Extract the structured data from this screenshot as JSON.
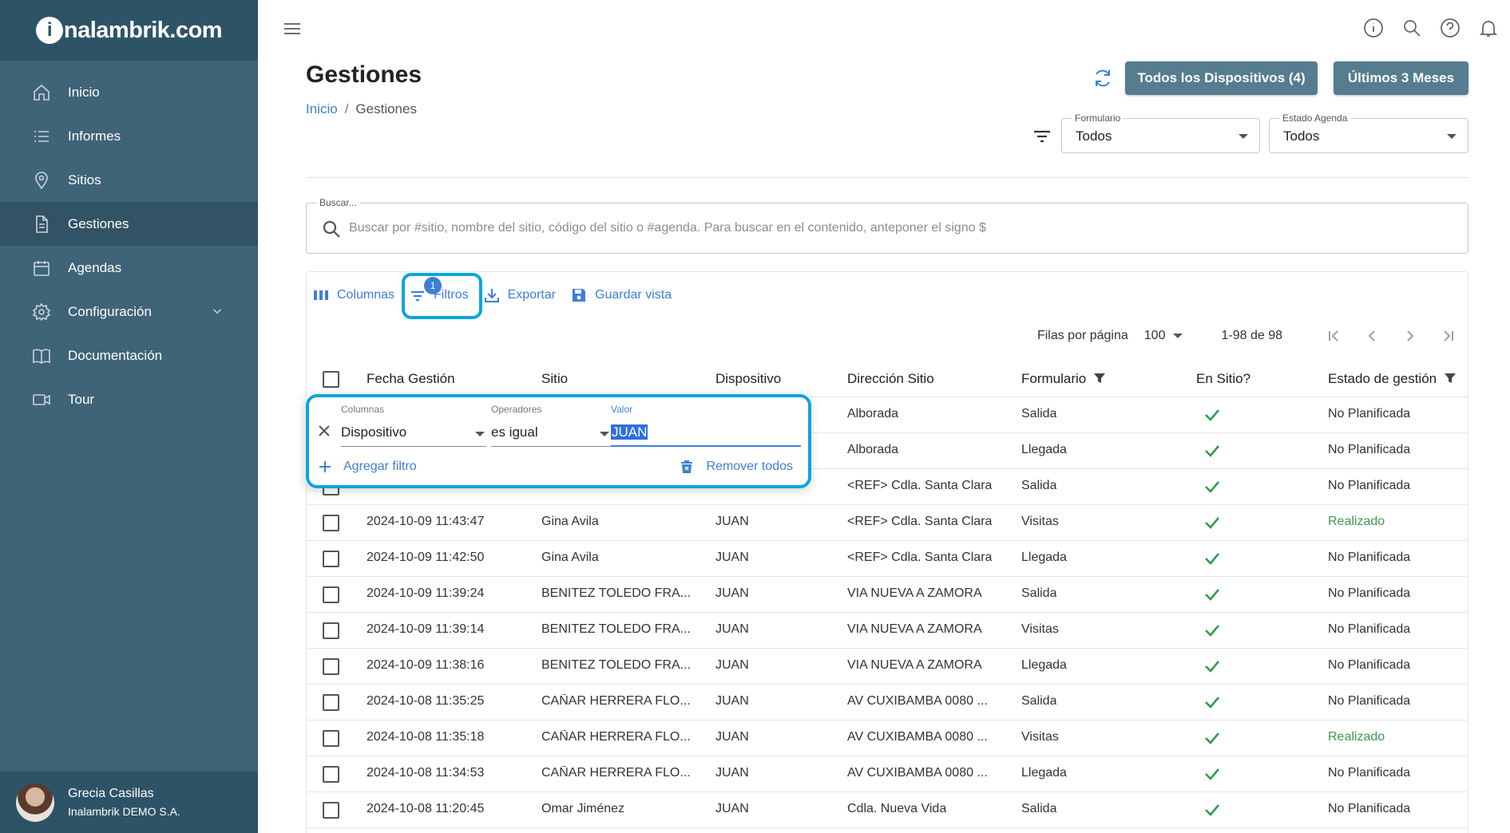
{
  "brand": {
    "logo_text": "nalambrik.com",
    "logo_initial": "i"
  },
  "sidebar": {
    "items": [
      {
        "label": "Inicio"
      },
      {
        "label": "Informes"
      },
      {
        "label": "Sitios"
      },
      {
        "label": "Gestiones"
      },
      {
        "label": "Agendas"
      },
      {
        "label": "Configuración"
      },
      {
        "label": "Documentación"
      },
      {
        "label": "Tour"
      }
    ],
    "active": "Gestiones"
  },
  "user": {
    "name": "Grecia Casillas",
    "org": "Inalambrik DEMO S.A."
  },
  "header": {
    "title": "Gestiones",
    "breadcrumb_home": "Inicio",
    "breadcrumb_sep": "/",
    "breadcrumb_current": "Gestiones",
    "btn_devices": "Todos los Dispositivos (4)",
    "btn_months": "Últimos 3 Meses"
  },
  "selects": {
    "formulario": {
      "label": "Formulario",
      "value": "Todos"
    },
    "estado": {
      "label": "Estado Agenda",
      "value": "Todos"
    }
  },
  "search": {
    "label": "Buscar...",
    "placeholder": "Buscar por #sitio, nombre del sitio, código del sitio o #agenda. Para buscar en el contenido, anteponer el signo $"
  },
  "toolbar": {
    "columns": "Columnas",
    "filters": "Filtros",
    "filters_badge": "1",
    "export": "Exportar",
    "save_view": "Guardar vista"
  },
  "pager": {
    "rows_label": "Filas por página",
    "rows_value": "100",
    "range": "1-98 de 98"
  },
  "table": {
    "columns": [
      "Fecha Gestión",
      "Sitio",
      "Dispositivo",
      "Dirección Sitio",
      "Formulario",
      "En Sitio?",
      "Estado de gestión"
    ],
    "rows": [
      {
        "fecha": "",
        "sitio": "",
        "disp": "",
        "dir": "Alborada",
        "form": "Salida",
        "estado": "No Planificada",
        "done": false
      },
      {
        "fecha": "",
        "sitio": "",
        "disp": "",
        "dir": "Alborada",
        "form": "Llegada",
        "estado": "No Planificada",
        "done": false
      },
      {
        "fecha": "",
        "sitio": "",
        "disp": "",
        "dir": "<REF> Cdla. Santa Clara",
        "form": "Salida",
        "estado": "No Planificada",
        "done": false
      },
      {
        "fecha": "2024-10-09 11:43:47",
        "sitio": "Gina Avila",
        "disp": "JUAN",
        "dir": "<REF> Cdla. Santa Clara",
        "form": "Visitas",
        "estado": "Realizado",
        "done": true
      },
      {
        "fecha": "2024-10-09 11:42:50",
        "sitio": "Gina Avila",
        "disp": "JUAN",
        "dir": "<REF> Cdla. Santa Clara",
        "form": "Llegada",
        "estado": "No Planificada",
        "done": false
      },
      {
        "fecha": "2024-10-09 11:39:24",
        "sitio": "BENITEZ TOLEDO FRA...",
        "disp": "JUAN",
        "dir": "VIA NUEVA A ZAMORA",
        "form": "Salida",
        "estado": "No Planificada",
        "done": false
      },
      {
        "fecha": "2024-10-09 11:39:14",
        "sitio": "BENITEZ TOLEDO FRA...",
        "disp": "JUAN",
        "dir": "VIA NUEVA A ZAMORA",
        "form": "Visitas",
        "estado": "No Planificada",
        "done": false
      },
      {
        "fecha": "2024-10-09 11:38:16",
        "sitio": "BENITEZ TOLEDO FRA...",
        "disp": "JUAN",
        "dir": "VIA NUEVA A ZAMORA",
        "form": "Llegada",
        "estado": "No Planificada",
        "done": false
      },
      {
        "fecha": "2024-10-08 11:35:25",
        "sitio": "CAÑAR HERRERA FLO...",
        "disp": "JUAN",
        "dir": "AV CUXIBAMBA 0080 ...",
        "form": "Salida",
        "estado": "No Planificada",
        "done": false
      },
      {
        "fecha": "2024-10-08 11:35:18",
        "sitio": "CAÑAR HERRERA FLO...",
        "disp": "JUAN",
        "dir": "AV CUXIBAMBA 0080 ...",
        "form": "Visitas",
        "estado": "Realizado",
        "done": true
      },
      {
        "fecha": "2024-10-08 11:34:53",
        "sitio": "CAÑAR HERRERA FLO...",
        "disp": "JUAN",
        "dir": "AV CUXIBAMBA 0080 ...",
        "form": "Llegada",
        "estado": "No Planificada",
        "done": false
      },
      {
        "fecha": "2024-10-08 11:20:45",
        "sitio": "Omar Jiménez",
        "disp": "JUAN",
        "dir": "Cdla. Nueva Vida",
        "form": "Salida",
        "estado": "No Planificada",
        "done": false
      }
    ]
  },
  "filter_panel": {
    "columns_label": "Columnas",
    "columns_value": "Dispositivo",
    "operators_label": "Operadores",
    "operators_value": "es igual",
    "value_label": "Valor",
    "value_value": "JUAN",
    "add_filter": "Agregar filtro",
    "remove_all": "Remover todos"
  },
  "colors": {
    "sidebar": "#3f6377",
    "sidebar_dark": "#2e5367",
    "accent": "#3e7fd6",
    "button": "#557c8f",
    "highlight": "#0ba5e0",
    "check": "#2e9d4c"
  }
}
